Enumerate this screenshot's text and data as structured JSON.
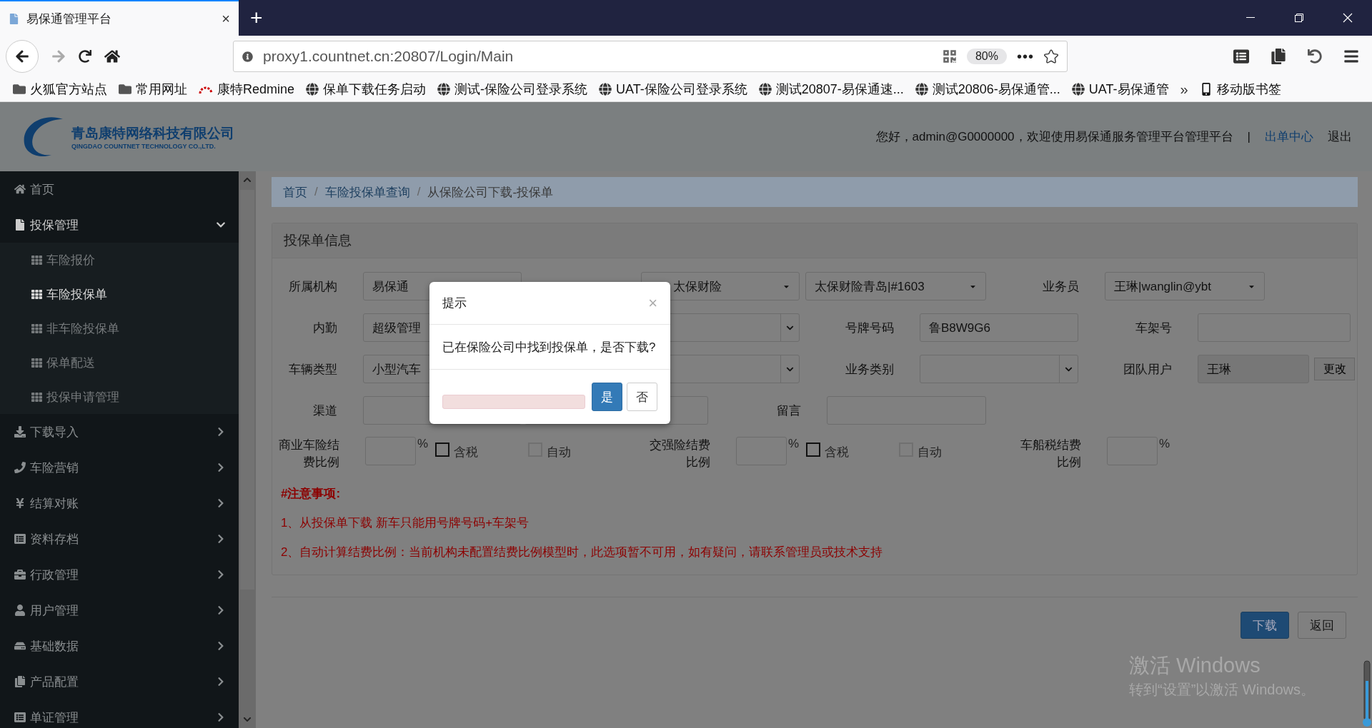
{
  "browser": {
    "tab": {
      "title": "易保通管理平台",
      "close": "×"
    },
    "new_tab": "+",
    "url": "proxy1.countnet.cn:20807/Login/Main",
    "zoom": "80%",
    "more": "•••",
    "bookmarks": [
      {
        "kind": "folder",
        "label": "火狐官方站点"
      },
      {
        "kind": "folder",
        "label": "常用网址"
      },
      {
        "kind": "redmine",
        "label": "康特Redmine"
      },
      {
        "kind": "globe",
        "label": "保单下载任务启动"
      },
      {
        "kind": "globe",
        "label": "测试-保险公司登录系统"
      },
      {
        "kind": "globe",
        "label": "UAT-保险公司登录系统"
      },
      {
        "kind": "globe",
        "label": "测试20807-易保通速..."
      },
      {
        "kind": "globe",
        "label": "测试20806-易保通管..."
      },
      {
        "kind": "globe",
        "label": "UAT-易保通管"
      }
    ],
    "bookmarks_more": "»",
    "mobile_bookmarks": "移动版书签"
  },
  "header": {
    "company": "青岛康特网络科技有限公司",
    "company_en": "QINGDAO COUNTNET TECHNOLOGY CO.,LTD.",
    "greeting": "您好，admin@G0000000，欢迎使用易保通服务管理平台管理平台",
    "separator": "|",
    "link": "出单中心",
    "logout": "退出"
  },
  "sidebar": {
    "items": [
      {
        "label": "首页",
        "expanded": false
      },
      {
        "label": "投保管理",
        "expanded": true,
        "children": [
          {
            "label": "车险报价",
            "selected": false
          },
          {
            "label": "车险投保单",
            "selected": true
          },
          {
            "label": "非车险投保单",
            "selected": false
          },
          {
            "label": "保单配送",
            "selected": false
          },
          {
            "label": "投保申请管理",
            "selected": false
          }
        ]
      },
      {
        "label": "下载导入",
        "expanded": false
      },
      {
        "label": "车险营销",
        "expanded": false
      },
      {
        "label": "结算对账",
        "expanded": false
      },
      {
        "label": "资料存档",
        "expanded": false
      },
      {
        "label": "行政管理",
        "expanded": false
      },
      {
        "label": "用户管理",
        "expanded": false
      },
      {
        "label": "基础数据",
        "expanded": false
      },
      {
        "label": "产品配置",
        "expanded": false
      },
      {
        "label": "单证管理",
        "expanded": false
      }
    ]
  },
  "breadcrumb": [
    "首页",
    "车险投保单查询",
    "从保险公司下载-投保单"
  ],
  "breadcrumb_separator": "/",
  "panel": {
    "title": "投保单信息",
    "org": {
      "label": "所属机构",
      "value": "易保通"
    },
    "insurer": {
      "company": "太保财险",
      "branch": "太保财险青岛|#1603"
    },
    "salesman": {
      "label": "业务员",
      "value": "王琳|wanglin@ybt"
    },
    "staff": {
      "label": "内勤",
      "value": "超级管理"
    },
    "plate": {
      "label": "号牌号码",
      "value": "鲁B8W9G6"
    },
    "vin": {
      "label": "车架号"
    },
    "vehicle_type": {
      "label": "车辆类型",
      "value": "小型汽车"
    },
    "business_type": {
      "label": "业务类别"
    },
    "team_user": {
      "label": "团队用户",
      "value": "王琳",
      "button": "更改"
    },
    "channel": {
      "label": "渠道"
    },
    "message": {
      "label": "留言"
    },
    "ratios": [
      {
        "label": "商业车险结费比例",
        "unit": "%",
        "tax": {
          "label": "含税",
          "checked": false
        },
        "auto": {
          "label": "自动",
          "checked": false,
          "disabled": true
        }
      },
      {
        "label": "交强险结费比例",
        "unit": "%",
        "tax": {
          "label": "含税",
          "checked": false
        },
        "auto": {
          "label": "自动",
          "checked": false,
          "disabled": true
        }
      },
      {
        "label": "车船税结费比例",
        "unit": "%"
      }
    ],
    "notes_title": "#注意事项:",
    "notes": [
      "1、从投保单下载 新车只能用号牌号码+车架号",
      "2、自动计算结费比例：当前机构未配置结费比例模型时，此选项暂不可用，如有疑问，请联系管理员或技术支持"
    ]
  },
  "actions": [
    "下载",
    "返回"
  ],
  "dialog": {
    "title": "提示",
    "close": "×",
    "message": "已在保险公司中找到投保单，是否下载?",
    "buttons": [
      "是",
      "否"
    ]
  },
  "os_notice": {
    "title": "激活 Windows",
    "text": "转到“设置”以激活 Windows。"
  }
}
